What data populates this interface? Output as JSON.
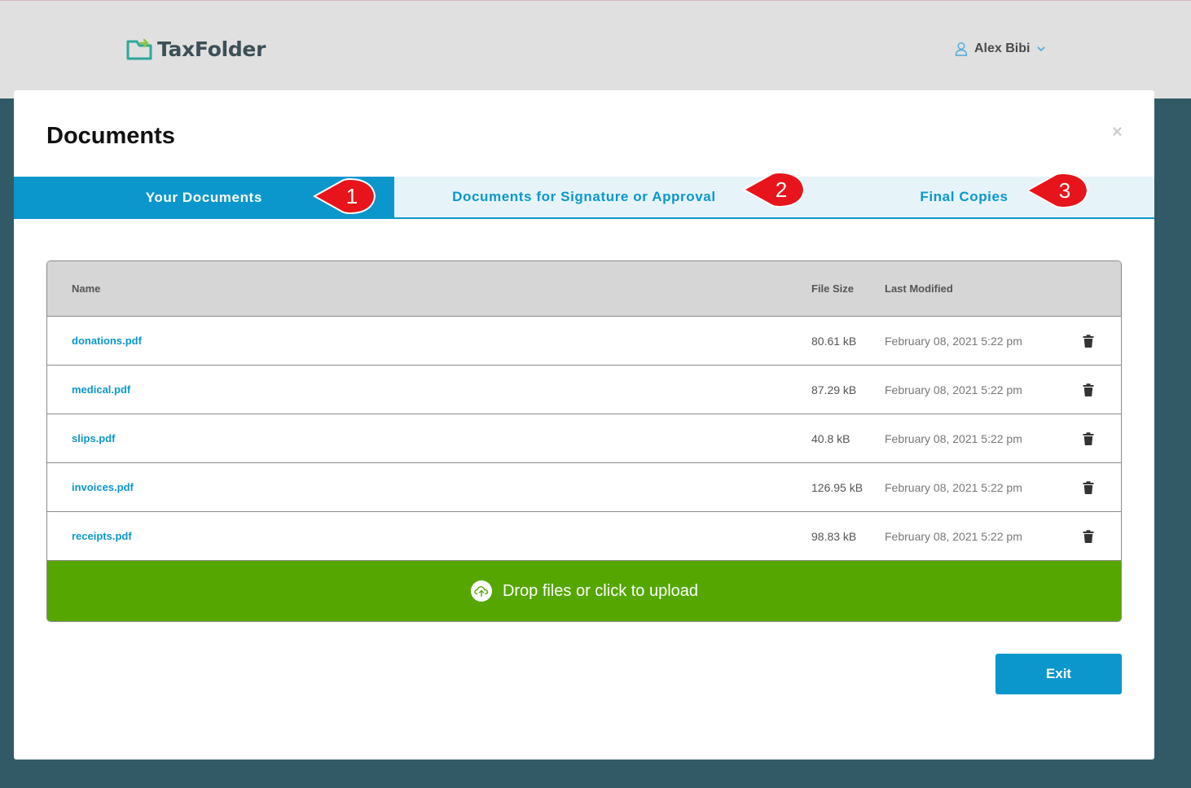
{
  "header": {
    "brand": "TaxFolder",
    "user_name": "Alex Bibi"
  },
  "modal": {
    "title": "Documents",
    "close_label": "×",
    "tabs": [
      {
        "label": "Your Documents",
        "callout": "1"
      },
      {
        "label": "Documents for Signature or Approval",
        "callout": "2"
      },
      {
        "label": "Final Copies",
        "callout": "3"
      }
    ],
    "table": {
      "headers": {
        "name": "Name",
        "size": "File Size",
        "modified": "Last Modified"
      },
      "rows": [
        {
          "name": "donations.pdf",
          "size": "80.61 kB",
          "modified": "February 08, 2021 5:22 pm"
        },
        {
          "name": "medical.pdf",
          "size": "87.29 kB",
          "modified": "February 08, 2021 5:22 pm"
        },
        {
          "name": "slips.pdf",
          "size": "40.8 kB",
          "modified": "February 08, 2021 5:22 pm"
        },
        {
          "name": "invoices.pdf",
          "size": "126.95 kB",
          "modified": "February 08, 2021 5:22 pm"
        },
        {
          "name": "receipts.pdf",
          "size": "98.83 kB",
          "modified": "February 08, 2021 5:22 pm"
        }
      ]
    },
    "upload_label": "Drop files or click to upload",
    "exit_label": "Exit"
  },
  "colors": {
    "accent": "#0b97cc",
    "upload_green": "#55a700",
    "background": "#315a66",
    "callout_red": "#e8141b"
  },
  "icons": {
    "logo": "folder-arrow-icon",
    "user": "user-icon",
    "chevron": "chevron-down-icon",
    "trash": "trash-icon",
    "upload": "cloud-upload-icon",
    "close": "close-icon"
  }
}
